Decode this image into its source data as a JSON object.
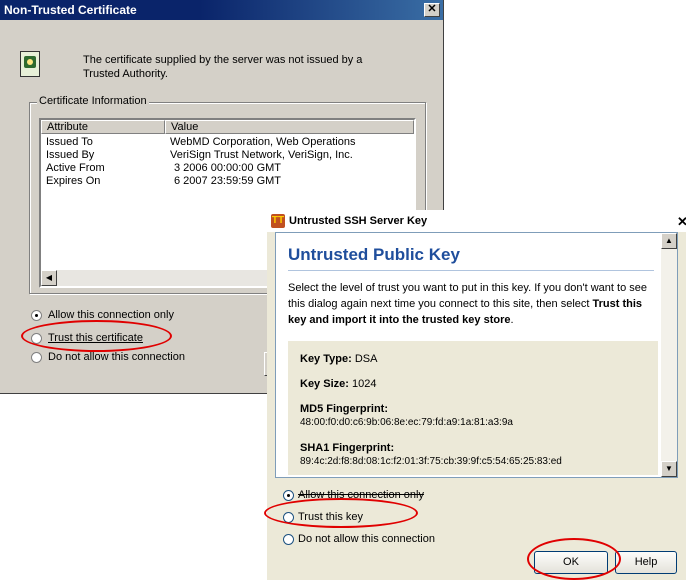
{
  "dialog1": {
    "title": "Non-Trusted Certificate",
    "close_glyph": "✕",
    "intro_text": "The certificate supplied by the server was not issued by a Trusted Authority.",
    "group_title": "Certificate Information",
    "columns": [
      "Attribute",
      "Value"
    ],
    "rows": [
      {
        "attribute": "Issued To",
        "value": "WebMD Corporation, Web Operations"
      },
      {
        "attribute": "Issued By",
        "value": "VeriSign Trust Network, VeriSign, Inc."
      },
      {
        "attribute": "Active From",
        "value": "3 2006 00:00:00 GMT"
      },
      {
        "attribute": "Expires On",
        "value": "6 2007 23:59:59 GMT"
      }
    ],
    "options": [
      {
        "label": "Allow this connection only",
        "checked": true
      },
      {
        "label": "Trust this certificate",
        "checked": false
      },
      {
        "label": "Do not allow this connection",
        "checked": false
      }
    ]
  },
  "dialog2": {
    "title": "Untrusted SSH Server Key",
    "close_glyph": "✕",
    "heading": "Untrusted Public Key",
    "description_plain": "Select the level of trust you want to put in this key. If you don't want to see this dialog again next time you connect to this site, then select",
    "description_bold": "Trust this key and import it into the trusted key store",
    "description_end": ".",
    "key_type_label": "Key Type:",
    "key_type_value": "DSA",
    "key_size_label": "Key Size:",
    "key_size_value": "1024",
    "md5_label": "MD5 Fingerprint:",
    "md5_value": "48:00:f0:d0:c6:9b:06:8e:ec:79:fd:a9:1a:81:a3:9a",
    "sha1_label": "SHA1 Fingerprint:",
    "sha1_value": "89:4c:2d:f8:8d:08:1c:f2:01:3f:75:cb:39:9f:c5:54:65:25:83:ed",
    "options": [
      {
        "label": "Allow this connection only",
        "checked": true
      },
      {
        "label": "Trust this key",
        "checked": false
      },
      {
        "label": "Do not allow this connection",
        "checked": false
      }
    ],
    "ok_label": "OK",
    "help_label": "Help"
  },
  "colors": {
    "highlight_ellipse": "#e00000",
    "heading_blue": "#1f4e9c",
    "title_bar_blue": "#0a246a"
  }
}
